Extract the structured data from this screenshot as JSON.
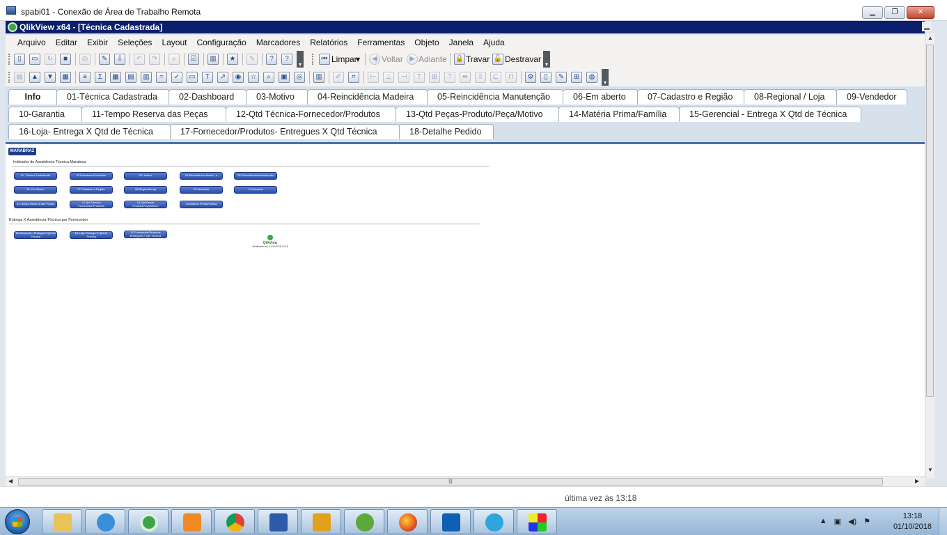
{
  "rdp": {
    "title": "spabi01 - Conexão de Área de Trabalho Remota"
  },
  "qv": {
    "title": "QlikView x64 - [Técnica Cadastrada]"
  },
  "menu": [
    "Arquivo",
    "Editar",
    "Exibir",
    "Seleções",
    "Layout",
    "Configuração",
    "Marcadores",
    "Relatórios",
    "Ferramentas",
    "Objeto",
    "Janela",
    "Ajuda"
  ],
  "toolbar": {
    "clear": "Limpar",
    "back": "Voltar",
    "forward": "Adiante",
    "lock": "Travar",
    "unlock": "Destravar"
  },
  "tabs": {
    "row1": [
      "Info",
      "01-Técnica Cadastrada",
      "02-Dashboard",
      "03-Motivo",
      "04-Reincidência Madeira",
      "05-Reincidência Manutenção",
      "06-Em aberto",
      "07-Cadastro e Região",
      "08-Regional / Loja",
      "09-Vendedor"
    ],
    "row2": [
      "10-Garantia",
      "11-Tempo Reserva das Peças",
      "12-Qtd Técnica-Fornecedor/Produtos",
      "13-Qtd Peças-Produto/Peça/Motivo",
      "14-Matéria Prima/Família",
      "15-Gerencial - Entrega X Qtd de Técnica"
    ],
    "row3": [
      "16-Loja- Entrega X Qtd de Técnica",
      "17-Fornecedor/Produtos- Entregues X Qtd Técnica",
      "18-Detalhe Pedido"
    ]
  },
  "sheet": {
    "logo": "MARABRAZ",
    "section1_title": "Indicador de Assistência Técnica Marabraz",
    "section2_title": "Entrega X Assistência Técnica por Fornecedor",
    "buttons1": [
      "01- Técnica Cadastrada",
      "02-Dashboard/Cadastro",
      "03- Motivo",
      "04-Reincidência Madei...a",
      "05-Reincidência Manutenção",
      "06- Em Aberto",
      "07-Cadastro e Região",
      "08-Regional/Loja",
      "09-Vendedor",
      "10-Garantia",
      "11-Tempo Reserva das Peças",
      "12-Qtd Técnica Fornecedor/Produtos",
      "13-Qtd Peças Produto/Peça/Motivo",
      "14-Matéria Prima/Família"
    ],
    "buttons2": [
      "15-Gerencial - Entrega X Qtd de Técnica",
      "16-Loja- Entrega X Qtd de Técnica",
      "17-Fornecedor/Produtos Entregues X Qtd Técnica"
    ],
    "footer_brand": "QlikView",
    "footer_updated": "Atualizado em: 01/10/2018 13:18"
  },
  "status": {
    "text": "última vez às 13:18"
  },
  "clock": {
    "time": "13:18",
    "date": "01/10/2018"
  },
  "taskbar_icons": [
    "file-explorer-icon",
    "internet-explorer-icon",
    "qlikview-icon",
    "media-player-icon",
    "chrome-icon",
    "remote-desktop-icon",
    "app-chip-icon",
    "frog-app-icon",
    "firefox-icon",
    "outlook-icon",
    "telegram-icon",
    "paint-app-icon"
  ],
  "colors": {
    "qv_title": "#0c1e6e",
    "tab_bg": "#d6e1ec",
    "nav_button": "#2a4ea8",
    "taskbar": "#97b6d6"
  }
}
